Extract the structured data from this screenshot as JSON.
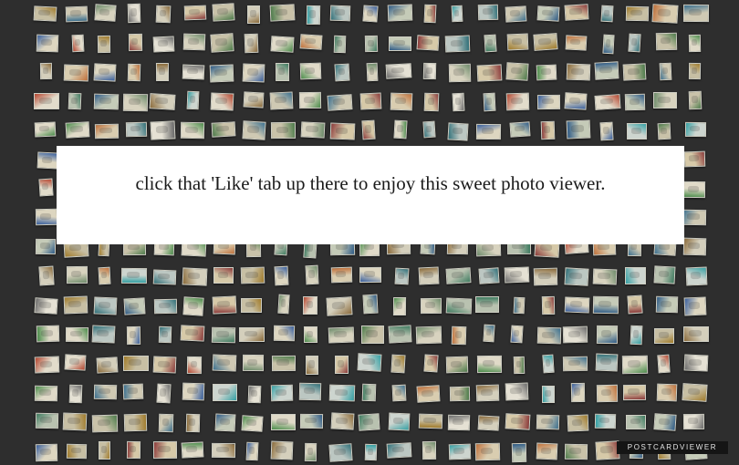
{
  "viewer": {
    "background_color": "#2e2e2e"
  },
  "overlay": {
    "message": "click that 'Like' tab up there to enjoy this sweet photo viewer."
  },
  "brand": {
    "label": "POSTCARDVIEWER"
  },
  "thumbnails": {
    "rows": 16,
    "columns": 23,
    "image-icon": "postcard-thumbnail"
  }
}
